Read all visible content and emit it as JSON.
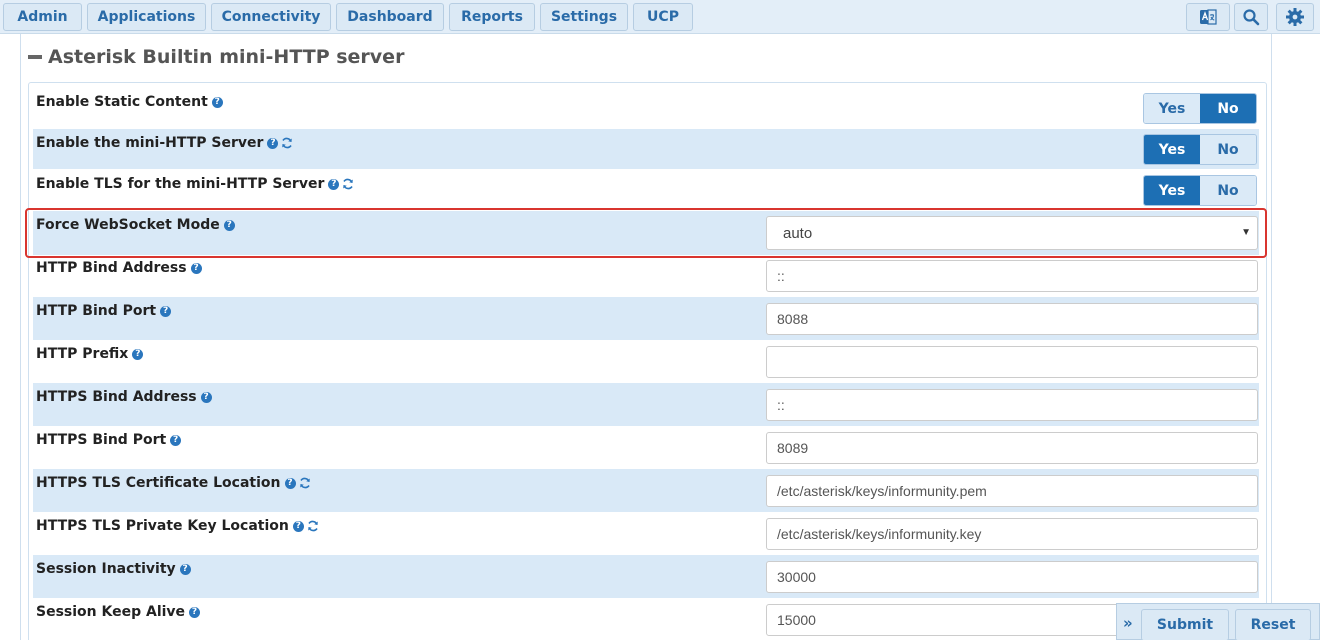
{
  "nav": {
    "items": [
      "Admin",
      "Applications",
      "Connectivity",
      "Dashboard",
      "Reports",
      "Settings",
      "UCP"
    ]
  },
  "section": {
    "title": "Asterisk Builtin mini-HTTP server"
  },
  "help_glyph": "?",
  "toggle_labels": {
    "yes": "Yes",
    "no": "No"
  },
  "settings": {
    "static_content": {
      "label": "Enable Static Content",
      "value": "No"
    },
    "mini_http": {
      "label": "Enable the mini-HTTP Server",
      "value": "Yes"
    },
    "tls": {
      "label": "Enable TLS for the mini-HTTP Server",
      "value": "Yes"
    },
    "websocket": {
      "label": "Force WebSocket Mode",
      "value": "auto"
    },
    "http_bind_address": {
      "label": "HTTP Bind Address",
      "value": "::"
    },
    "http_bind_port": {
      "label": "HTTP Bind Port",
      "value": "8088"
    },
    "http_prefix": {
      "label": "HTTP Prefix",
      "value": ""
    },
    "https_bind_address": {
      "label": "HTTPS Bind Address",
      "value": "::"
    },
    "https_bind_port": {
      "label": "HTTPS Bind Port",
      "value": "8089"
    },
    "tls_cert": {
      "label": "HTTPS TLS Certificate Location",
      "value": "/etc/asterisk/keys/informunity.pem"
    },
    "tls_key": {
      "label": "HTTPS TLS Private Key Location",
      "value": "/etc/asterisk/keys/informunity.key"
    },
    "session_inactivity": {
      "label": "Session Inactivity",
      "value": "30000"
    },
    "session_keep_alive": {
      "label": "Session Keep Alive",
      "value": "15000"
    }
  },
  "actions": {
    "expand": "»",
    "submit": "Submit",
    "reset": "Reset"
  },
  "colors": {
    "accent": "#1d6fb4",
    "highlight": "#d9352f",
    "row_alt": "#d9e9f7"
  }
}
